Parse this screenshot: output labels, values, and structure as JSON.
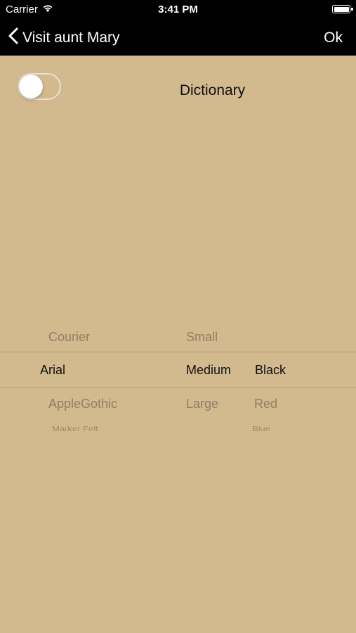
{
  "status_bar": {
    "carrier": "Carrier",
    "time": "3:41 PM"
  },
  "nav": {
    "back_label": "Visit aunt Mary",
    "ok_label": "Ok"
  },
  "toggle": {
    "on": false
  },
  "dictionary_label": "Dictionary",
  "picker": {
    "font_column": {
      "above": "Courier",
      "selected": "Arial",
      "below": "AppleGothic",
      "below2": "Marker Felt"
    },
    "size_column": {
      "above": "Small",
      "selected": "Medium",
      "below": "Large"
    },
    "color_column": {
      "selected": "Black",
      "below": "Red",
      "below2": "Blue"
    }
  },
  "colors": {
    "background": "#d3b98e",
    "bar": "#000000"
  }
}
